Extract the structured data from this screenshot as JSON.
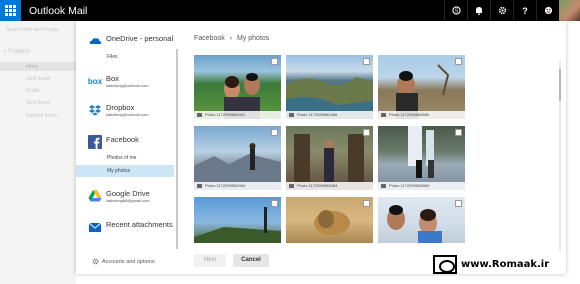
{
  "topbar": {
    "app_title": "Outlook Mail",
    "icons": [
      "skype-icon",
      "bell-icon",
      "gear-icon",
      "help-icon",
      "smile-icon"
    ]
  },
  "background": {
    "search_placeholder": "Search Mail and People",
    "folders_label": "Folders",
    "folders": [
      "Inbox",
      "Junk Email",
      "Drafts",
      "Sent Items",
      "Deleted Items"
    ]
  },
  "sources": {
    "onedrive": {
      "name": "OneDrive - personal",
      "sub": "Files"
    },
    "box": {
      "name": "Box",
      "email": "katieliang@outlook.com"
    },
    "dropbox": {
      "name": "Dropbox",
      "email": "katieliang@outlook.com"
    },
    "facebook": {
      "name": "Facebook",
      "sub1": "Photos of me",
      "sub2": "My photos"
    },
    "gdrive": {
      "name": "Google Drive",
      "email": "katieliang88@gmail.com"
    },
    "attachments": {
      "name": "Recent attachments"
    },
    "accounts_label": "Accounts and options"
  },
  "breadcrumb": {
    "root": "Facebook",
    "sep": "›",
    "current": "My photos"
  },
  "photos": [
    {
      "caption": "Photo 1172399560391"
    },
    {
      "caption": "Photo 1172399562466"
    },
    {
      "caption": "Photo 1172399563560"
    },
    {
      "caption": "Photo 1172399561094"
    },
    {
      "caption": "Photo 1172399562584"
    },
    {
      "caption": "Photo 1172399565860"
    },
    {
      "caption": ""
    },
    {
      "caption": ""
    },
    {
      "caption": ""
    }
  ],
  "buttons": {
    "next": "Next",
    "cancel": "Cancel"
  },
  "watermark": {
    "text": "www.Romaak.ir"
  },
  "colors": {
    "accent": "#0078d7",
    "selected": "#cde6f7",
    "topbar": "#000000"
  }
}
